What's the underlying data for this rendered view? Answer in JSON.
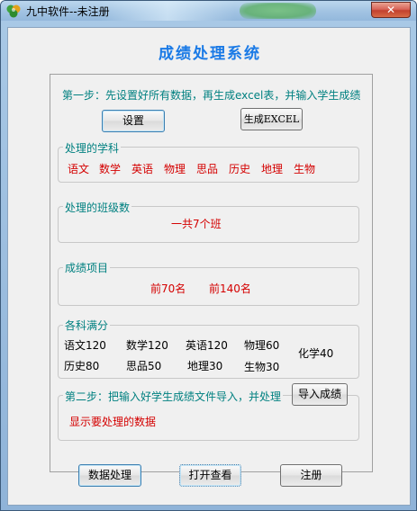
{
  "window": {
    "title": "九中软件--未注册",
    "close_label": "✕"
  },
  "app_title": "成绩处理系统",
  "step1": {
    "text": "第一步：先设置好所有数据，再生成excel表，并输入学生成绩",
    "settings_button": "设置",
    "generate_button": "生成EXCEL"
  },
  "subjects": {
    "legend": "处理的学科",
    "items": [
      "语文",
      "数学",
      "英语",
      "物理",
      "思品",
      "历史",
      "地理",
      "生物"
    ]
  },
  "classes": {
    "legend": "处理的班级数",
    "text": "一共7个班"
  },
  "score_items": {
    "legend": "成绩项目",
    "item1": "前70名",
    "item2": "前140名"
  },
  "full_marks": {
    "legend": "各科满分",
    "items": [
      "语文120",
      "数学120",
      "英语120",
      "物理60",
      "化学40",
      "历史80",
      "思品50",
      "地理30",
      "生物30"
    ]
  },
  "step2": {
    "legend": "第二步：把输入好学生成绩文件导入，并处理",
    "import_button": "导入成绩",
    "status": "显示要处理的数据"
  },
  "bottom_buttons": {
    "process": "数据处理",
    "open": "打开查看",
    "register": "注册"
  },
  "colors": {
    "title_blue": "#1a7ae6",
    "teal": "#008080",
    "red": "#d40000",
    "close_red": "#c2412e"
  }
}
